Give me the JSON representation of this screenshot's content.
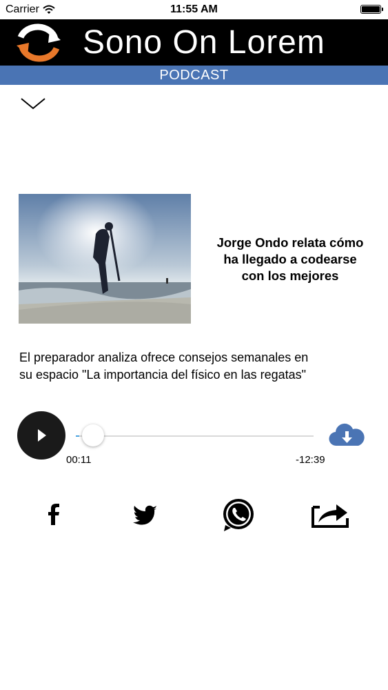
{
  "status_bar": {
    "carrier": "Carrier",
    "time": "11:55 AM"
  },
  "header": {
    "title": "Sono On Lorem",
    "logo_icon": "sync-arrows-icon",
    "logo_color": "#e8782a"
  },
  "section": {
    "label": "PODCAST",
    "color": "#4a74b4"
  },
  "collapse_icon": "chevron-down-icon",
  "episode": {
    "title_lines": [
      "Jorge Ondo relata cómo",
      "ha llegado a codearse",
      "con los mejores"
    ],
    "description_lines": [
      "El preparador analiza ofrece consejos semanales en",
      "su espacio \"La importancia del físico en las regatas\""
    ]
  },
  "player": {
    "elapsed": "00:11",
    "remaining": "-12:39",
    "progress_fraction": 0.014,
    "play_icon": "play-icon",
    "download_icon": "cloud-download-icon",
    "accent_color": "#4a74b4"
  },
  "share": [
    {
      "icon": "facebook-icon"
    },
    {
      "icon": "twitter-icon"
    },
    {
      "icon": "whatsapp-icon"
    },
    {
      "icon": "share-icon"
    }
  ]
}
